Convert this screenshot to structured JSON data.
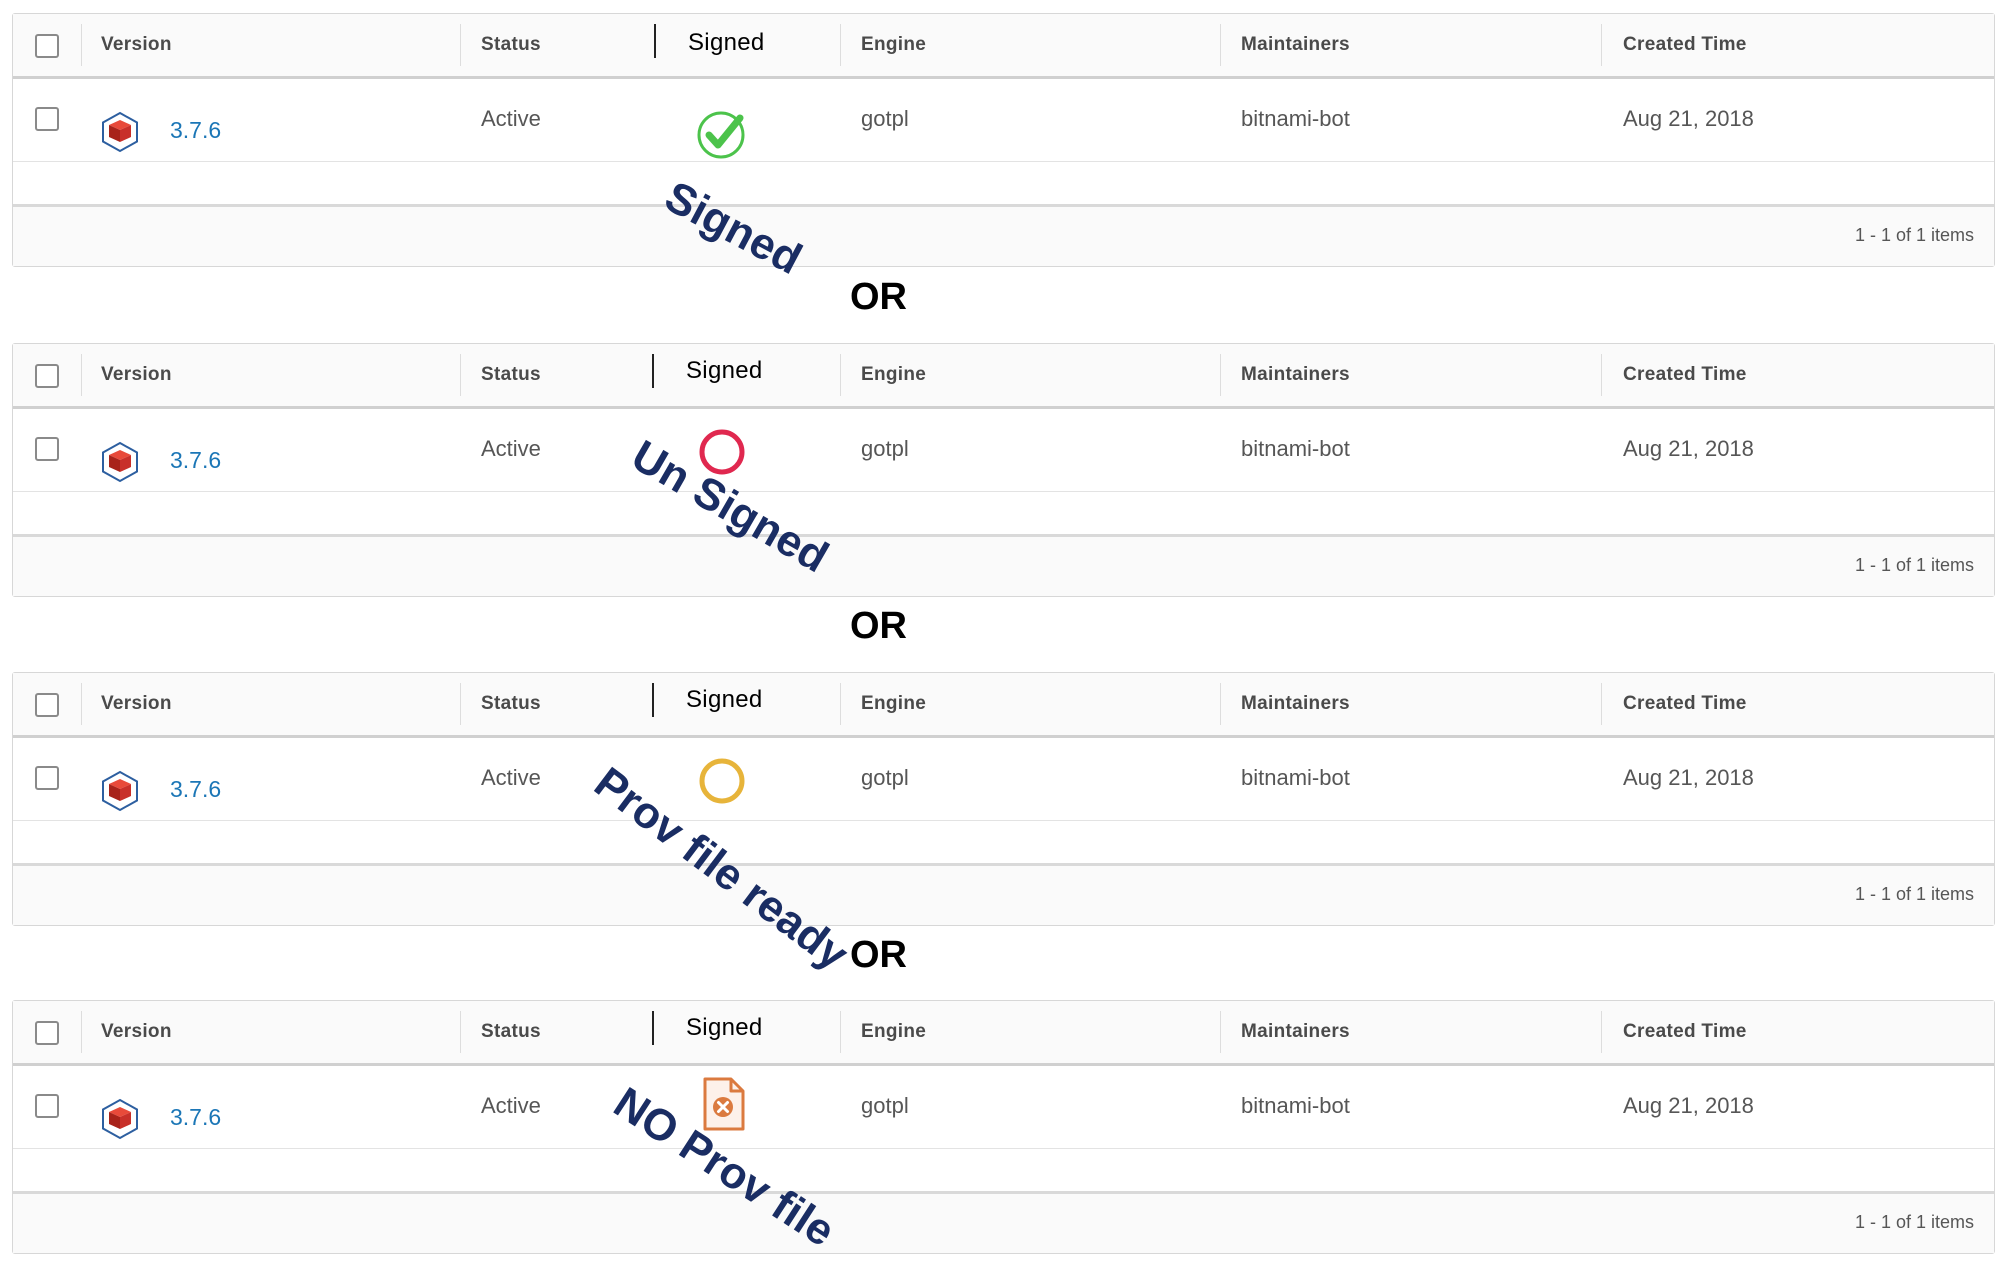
{
  "columns": {
    "version": "Version",
    "status": "Status",
    "signed": "Signed",
    "engine": "Engine",
    "maintainers": "Maintainers",
    "created": "Created Time"
  },
  "row": {
    "version": "3.7.6",
    "status": "Active",
    "engine": "gotpl",
    "maintainer": "bitnami-bot",
    "created": "Aug 21, 2018"
  },
  "pagination": "1 - 1 of 1 items",
  "separator": "OR",
  "variants": [
    {
      "annotation": "Signed",
      "icon": "signed-check-icon"
    },
    {
      "annotation": "Un Signed",
      "icon": "unsigned-red-circle-icon"
    },
    {
      "annotation": "Prov file ready",
      "icon": "prov-ready-yellow-circle-icon"
    },
    {
      "annotation": "NO Prov file",
      "icon": "no-prov-file-icon"
    }
  ],
  "colors": {
    "link": "#1b76b6",
    "signed_green": "#4cc34b",
    "unsigned_red": "#e0284f",
    "prov_yellow": "#e7b43a",
    "no_prov_orange": "#db7a3f",
    "annotation_navy": "#1a2d63"
  }
}
